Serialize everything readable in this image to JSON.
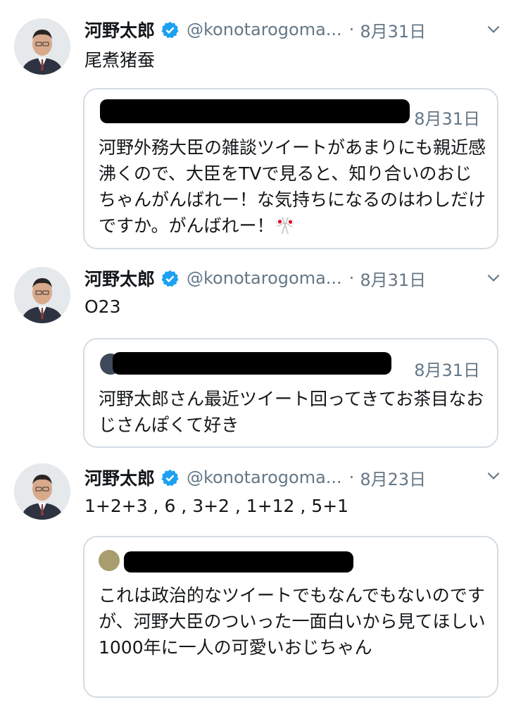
{
  "tweets": [
    {
      "name": "河野太郎",
      "handle": "@konotarogoma...",
      "dot": "·",
      "date": "8月31日",
      "text": "尾煮猪蚕",
      "quote": {
        "date": "8月31日",
        "text": "河野外務大臣の雑談ツイートがあまりにも親近感沸くので、大臣をTVで見ると、知り合いのおじちゃんがんばれー！な気持ちになるのはわしだけですか。がんばれー！🎌"
      }
    },
    {
      "name": "河野太郎",
      "handle": "@konotarogoma...",
      "dot": "·",
      "date": "8月31日",
      "text": "O23",
      "quote": {
        "date": "8月31日",
        "text": "河野太郎さん最近ツイート回ってきてお茶目なおじさんぽくて好き"
      }
    },
    {
      "name": "河野太郎",
      "handle": "@konotarogoma...",
      "dot": "·",
      "date": "8月23日",
      "text": "1+2+3 , 6 , 3+2 , 1+12 , 5+1",
      "quote": {
        "date": "",
        "text": "これは政治的なツイートでもなんでもないのですが、河野大臣のついった一面白いから見てほしい　1000年に一人の可愛いおじちゃん"
      }
    }
  ],
  "icons": {
    "verified": "verified-badge-icon",
    "menu": "chevron-down-icon"
  },
  "colors": {
    "verified": "#1da1f2",
    "meta": "#657786",
    "border": "#d5dce3"
  }
}
